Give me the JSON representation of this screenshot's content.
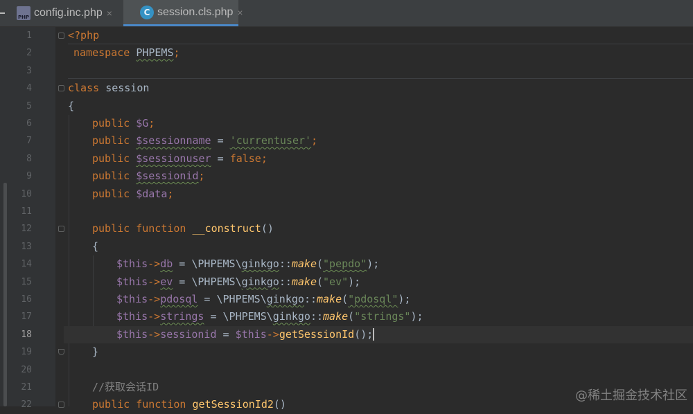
{
  "tabs": [
    {
      "icon": "php-file-icon",
      "icon_text": "PHP",
      "label": "config.inc.php",
      "active": false
    },
    {
      "icon": "class-file-icon",
      "icon_text": "C",
      "label": "session.cls.php",
      "active": true
    }
  ],
  "tab_close_glyph": "×",
  "editor": {
    "current_line": 18,
    "line_numbers": [
      "1",
      "2",
      "3",
      "4",
      "5",
      "6",
      "7",
      "8",
      "9",
      "10",
      "11",
      "12",
      "13",
      "14",
      "15",
      "16",
      "17",
      "18",
      "19",
      "20",
      "21",
      "22"
    ],
    "code": {
      "l1": {
        "open": "<?php"
      },
      "l2": {
        "kw": "namespace",
        "ns": "PHPEMS",
        "semi": ";"
      },
      "l4": {
        "kw": "class",
        "name": "session"
      },
      "l5": {
        "brace": "{"
      },
      "l6": {
        "kw": "public",
        "var": "$G",
        "semi": ";"
      },
      "l7": {
        "kw": "public",
        "var": "$sessionname",
        "op": " = ",
        "str": "'currentuser'",
        "semi": ";"
      },
      "l8": {
        "kw": "public",
        "var": "$sessionuser",
        "op": " = ",
        "val": "false",
        "semi": ";"
      },
      "l9": {
        "kw": "public",
        "var": "$sessionid",
        "semi": ";"
      },
      "l10": {
        "kw": "public",
        "var": "$data",
        "semi": ";"
      },
      "l12": {
        "kw1": "public",
        "kw2": "function",
        "fn": "__construct",
        "paren": "()"
      },
      "l13": {
        "brace": "{"
      },
      "l14": {
        "this": "$this",
        "arrow": "->",
        "prop": "db",
        "op": " = \\PHPEMS\\",
        "cls": "ginkgo",
        "dc": "::",
        "m": "make",
        "p1": "(",
        "str": "\"pepdo\"",
        "p2": ");"
      },
      "l15": {
        "this": "$this",
        "arrow": "->",
        "prop": "ev",
        "op": " = \\PHPEMS\\",
        "cls": "ginkgo",
        "dc": "::",
        "m": "make",
        "p1": "(",
        "str": "\"ev\"",
        "p2": ");"
      },
      "l16": {
        "this": "$this",
        "arrow": "->",
        "prop": "pdosql",
        "op": " = \\PHPEMS\\",
        "cls": "ginkgo",
        "dc": "::",
        "m": "make",
        "p1": "(",
        "str": "\"pdosql\"",
        "p2": ");"
      },
      "l17": {
        "this": "$this",
        "arrow": "->",
        "prop": "strings",
        "op": " = \\PHPEMS\\",
        "cls": "ginkgo",
        "dc": "::",
        "m": "make",
        "p1": "(",
        "str": "\"strings\"",
        "p2": ");"
      },
      "l18": {
        "this": "$this",
        "arrow": "->",
        "prop": "sessionid",
        "op": " = ",
        "this2": "$this",
        "arrow2": "->",
        "fn": "getSessionId",
        "tail": "();"
      },
      "l19": {
        "brace": "}"
      },
      "l21": {
        "comment": "//获取会话ID"
      },
      "l22": {
        "kw1": "public",
        "kw2": "function",
        "fn": "getSessionId2",
        "paren": "()"
      }
    }
  },
  "watermark": "@稀土掘金技术社区",
  "colors": {
    "background": "#2b2b2b",
    "keyword": "#cc7832",
    "function": "#ffc66d",
    "variable": "#9876aa",
    "string": "#6a8759",
    "comment": "#808080",
    "active_tab_underline": "#4a88c7"
  }
}
